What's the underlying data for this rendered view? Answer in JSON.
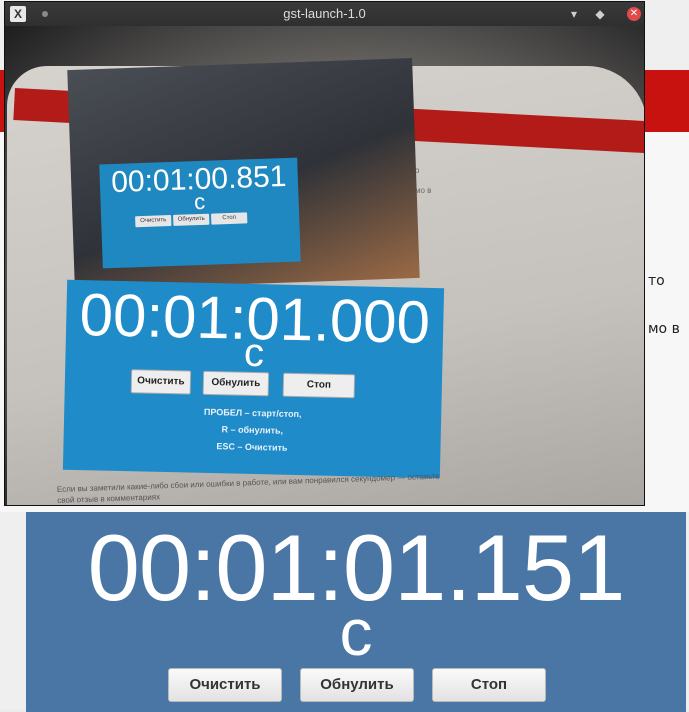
{
  "window": {
    "title": "gst-launch-1.0",
    "app_icon": "x-app-icon",
    "buttons": [
      "minimize",
      "maximize",
      "close"
    ]
  },
  "background_page": {
    "side_text": [
      "то",
      "мо в"
    ],
    "colors": {
      "red_bar": "#c8120f",
      "page": "#f7f7f7"
    }
  },
  "camera_feed": {
    "inner_stopwatch": {
      "time": "00:01:00.851",
      "unit": "с",
      "buttons": [
        "Очистить",
        "Обнулить",
        "Стоп"
      ]
    },
    "stopwatch": {
      "time": "00:01:01.000",
      "unit": "с",
      "buttons": [
        "Очистить",
        "Обнулить",
        "Стоп"
      ],
      "hints": [
        "ПРОБЕЛ – старт/стоп,",
        "R – обнулить,",
        "ESC – Очистить"
      ]
    },
    "bottom_text": "Если вы заметили какие-либо сбои или ошибки в работе, или вам понравился секундомер — оставьте свой отзыв в комментариях",
    "side_text": [
      "о",
      "мо в"
    ]
  },
  "stopwatch": {
    "time": "00:01:01.151",
    "unit": "с",
    "buttons": {
      "clear": "Очистить",
      "reset": "Обнулить",
      "stop": "Стоп"
    },
    "color": "#4a76a5"
  }
}
